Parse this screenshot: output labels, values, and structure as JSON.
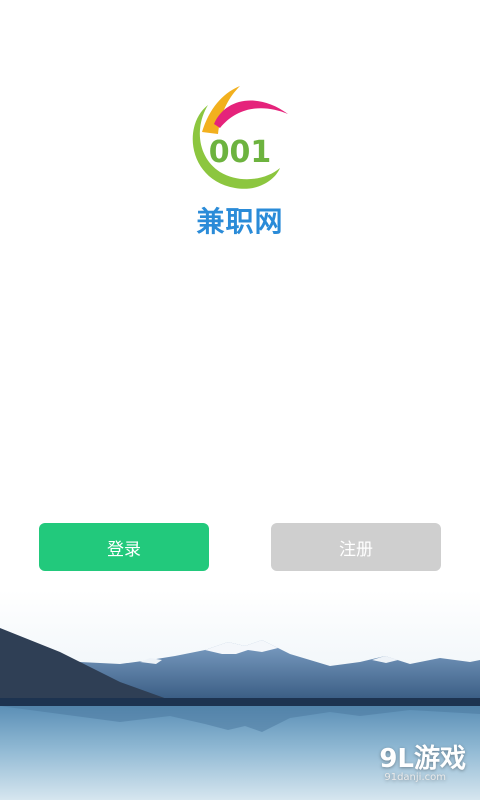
{
  "logo": {
    "number": "001",
    "name": "兼职网"
  },
  "actions": {
    "login_label": "登录",
    "register_label": "注册"
  },
  "watermark": {
    "main": "9L游戏",
    "sub": "91danji.com"
  },
  "colors": {
    "login": "#22c97c",
    "register": "#cfcfcf",
    "brand": "#2a8bd8"
  }
}
